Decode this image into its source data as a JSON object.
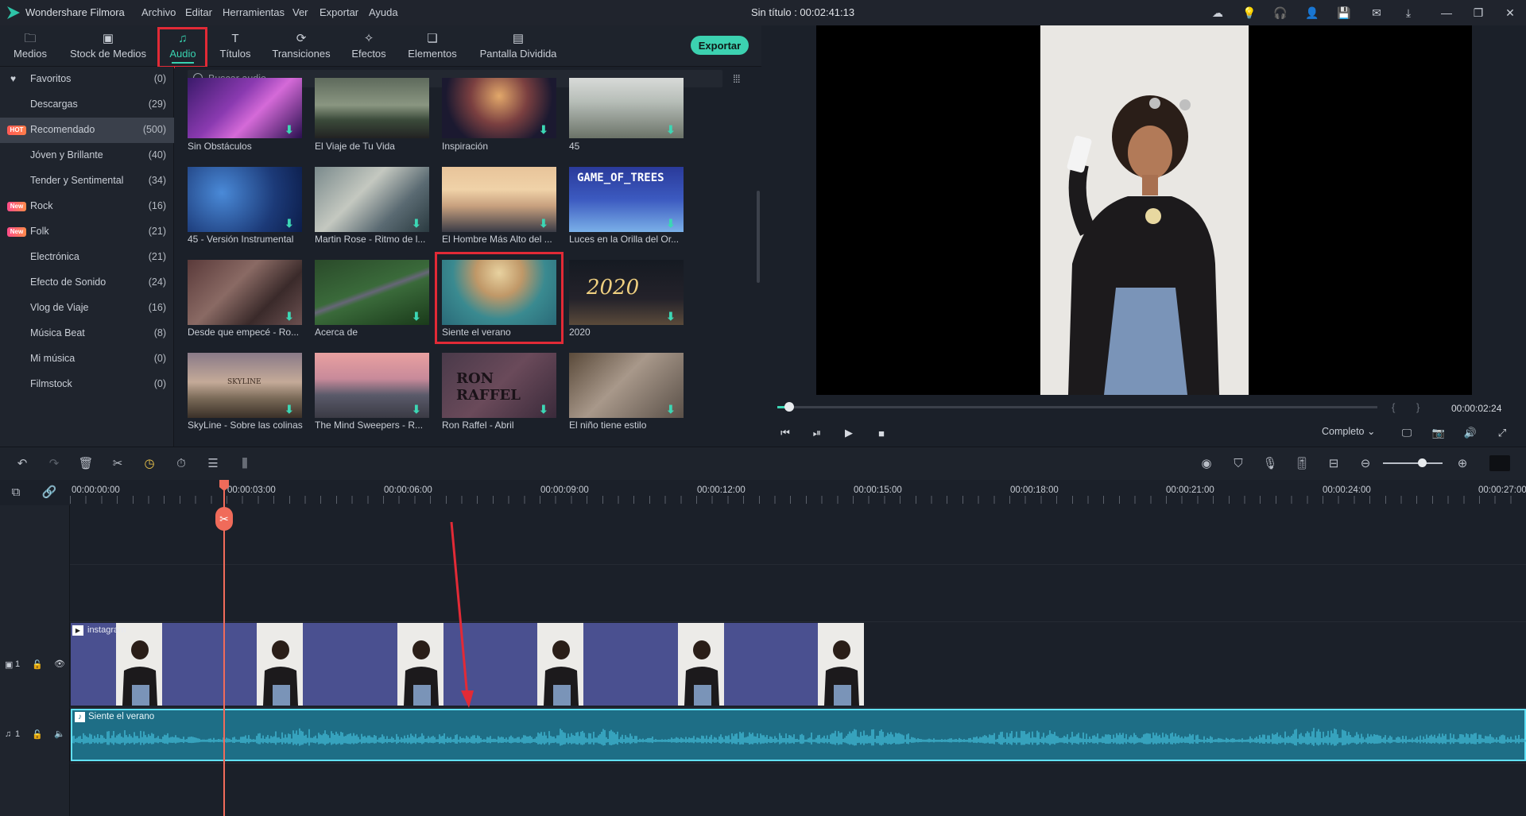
{
  "app": {
    "name": "Wondershare Filmora",
    "window_title": "Sin título : 00:02:41:13"
  },
  "menu": [
    "Archivo",
    "Editar",
    "Herramientas",
    "Ver",
    "Exportar",
    "Ayuda"
  ],
  "tabs": [
    {
      "label": "Medios",
      "icon": "folder-icon"
    },
    {
      "label": "Stock de Medios",
      "icon": "stock-media-icon"
    },
    {
      "label": "Audio",
      "icon": "music-note-icon",
      "active": true
    },
    {
      "label": "Títulos",
      "icon": "text-icon"
    },
    {
      "label": "Transiciones",
      "icon": "transition-icon"
    },
    {
      "label": "Efectos",
      "icon": "effects-icon"
    },
    {
      "label": "Elementos",
      "icon": "elements-icon"
    },
    {
      "label": "Pantalla Dividida",
      "icon": "split-screen-icon"
    }
  ],
  "export_label": "Exportar",
  "sidebar": {
    "categories": [
      {
        "label": "Favoritos",
        "count": "(0)",
        "icon": "heart-icon"
      },
      {
        "label": "Descargas",
        "count": "(29)"
      },
      {
        "label": "Recomendado",
        "count": "(500)",
        "badge": "HOT",
        "active": true
      },
      {
        "label": "Jóven y Brillante",
        "count": "(40)"
      },
      {
        "label": "Tender y Sentimental",
        "count": "(34)"
      },
      {
        "label": "Rock",
        "count": "(16)",
        "badge": "New"
      },
      {
        "label": "Folk",
        "count": "(21)",
        "badge": "New"
      },
      {
        "label": "Electrónica",
        "count": "(21)"
      },
      {
        "label": "Efecto de Sonido",
        "count": "(24)"
      },
      {
        "label": "Vlog de Viaje",
        "count": "(16)"
      },
      {
        "label": "Música Beat",
        "count": "(8)"
      },
      {
        "label": "Mi música",
        "count": "(0)"
      },
      {
        "label": "Filmstock",
        "count": "(0)"
      }
    ]
  },
  "search": {
    "placeholder": "Buscar audio"
  },
  "library": {
    "items": [
      {
        "title": "Sin Obstáculos"
      },
      {
        "title": "El Viaje de Tu Vida"
      },
      {
        "title": "Inspiración"
      },
      {
        "title": "45"
      },
      {
        "title": "45 - Versión Instrumental"
      },
      {
        "title": "Martin Rose - Ritmo de l..."
      },
      {
        "title": "El Hombre Más Alto del ..."
      },
      {
        "title": "Luces en la Orilla del Or..."
      },
      {
        "title": "Desde que empecé - Ro..."
      },
      {
        "title": "Acerca de"
      },
      {
        "title": "Siente el verano",
        "selected": true
      },
      {
        "title": "2020"
      },
      {
        "title": "SkyLine - Sobre las colinas"
      },
      {
        "title": "The Mind Sweepers - R..."
      },
      {
        "title": "Ron Raffel - Abril"
      },
      {
        "title": "El niño tiene estilo"
      }
    ],
    "thumb_texts": {
      "game_of_trees": "GAME_OF_TREES",
      "year": "2020",
      "skyline": "SKYLINE",
      "ron_raffel": "RON RAFFEL"
    }
  },
  "preview": {
    "timecode": "00:00:02:24",
    "quality": "Completo",
    "progress": 0.02
  },
  "timeline": {
    "ruler": [
      "00:00:00:00",
      "00:00:03:00",
      "00:00:06:00",
      "00:00:09:00",
      "00:00:12:00",
      "00:00:15:00",
      "00:00:18:00",
      "00:00:21:00",
      "00:00:24:00",
      "00:00:27:00"
    ],
    "video_track": {
      "label": "1",
      "clip_title": "instagram"
    },
    "audio_track": {
      "label": "1",
      "clip_title": "Siente el verano"
    },
    "zoom": 0.65
  },
  "colors": {
    "accent": "#38d3b0",
    "highlight": "#e22a36",
    "audio_clip": "#1e6e86",
    "video_clip": "#4a5090",
    "playhead": "#f06b5a"
  }
}
